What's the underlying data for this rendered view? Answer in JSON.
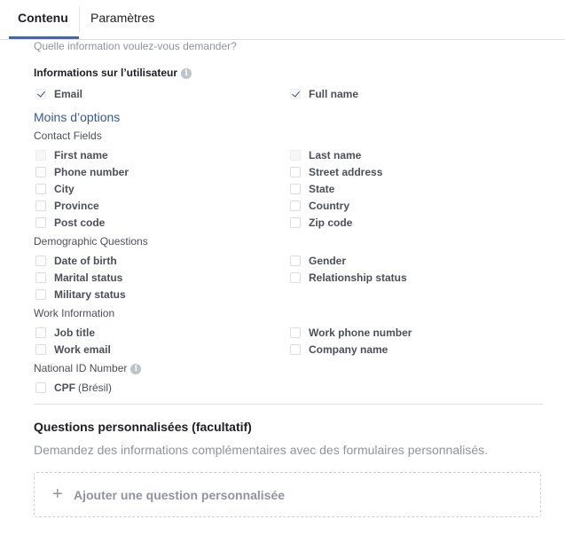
{
  "tabs": [
    {
      "label": "Contenu",
      "active": true
    },
    {
      "label": "Paramètres",
      "active": false
    }
  ],
  "subtitle": "Quelle information voulez-vous demander?",
  "user_info": {
    "title": "Informations sur l’utilisateur",
    "info_icon": "i",
    "email": {
      "label": "Email",
      "checked": true
    },
    "full_name": {
      "label": "Full name",
      "checked": true
    },
    "toggle_options": "Moins d’options"
  },
  "contact_fields": {
    "title": "Contact Fields",
    "items": [
      {
        "label": "First name",
        "checked": false
      },
      {
        "label": "Last name",
        "checked": false
      },
      {
        "label": "Phone number",
        "checked": false
      },
      {
        "label": "Street address",
        "checked": false
      },
      {
        "label": "City",
        "checked": false
      },
      {
        "label": "State",
        "checked": false
      },
      {
        "label": "Province",
        "checked": false
      },
      {
        "label": "Country",
        "checked": false
      },
      {
        "label": "Post code",
        "checked": false
      },
      {
        "label": "Zip code",
        "checked": false
      }
    ]
  },
  "demographic": {
    "title": "Demographic Questions",
    "items": [
      {
        "label": "Date of birth",
        "checked": false
      },
      {
        "label": "Gender",
        "checked": false
      },
      {
        "label": "Marital status",
        "checked": false
      },
      {
        "label": "Relationship status",
        "checked": false
      },
      {
        "label": "Military status",
        "checked": false
      }
    ]
  },
  "work": {
    "title": "Work Information",
    "items": [
      {
        "label": "Job title",
        "checked": false
      },
      {
        "label": "Work phone number",
        "checked": false
      },
      {
        "label": "Work email",
        "checked": false
      },
      {
        "label": "Company name",
        "checked": false
      }
    ]
  },
  "national_id": {
    "title": "National ID Number",
    "info_icon": "i",
    "cpf_label": "CPF",
    "cpf_sub": "(Brésil)",
    "checked": false
  },
  "custom": {
    "title": "Questions personnalisées (facultatif)",
    "description": "Demandez des informations complémentaires avec des formulaires personnalisés.",
    "add_plus": "+",
    "add_label": "Ajouter une question personnalisée"
  }
}
